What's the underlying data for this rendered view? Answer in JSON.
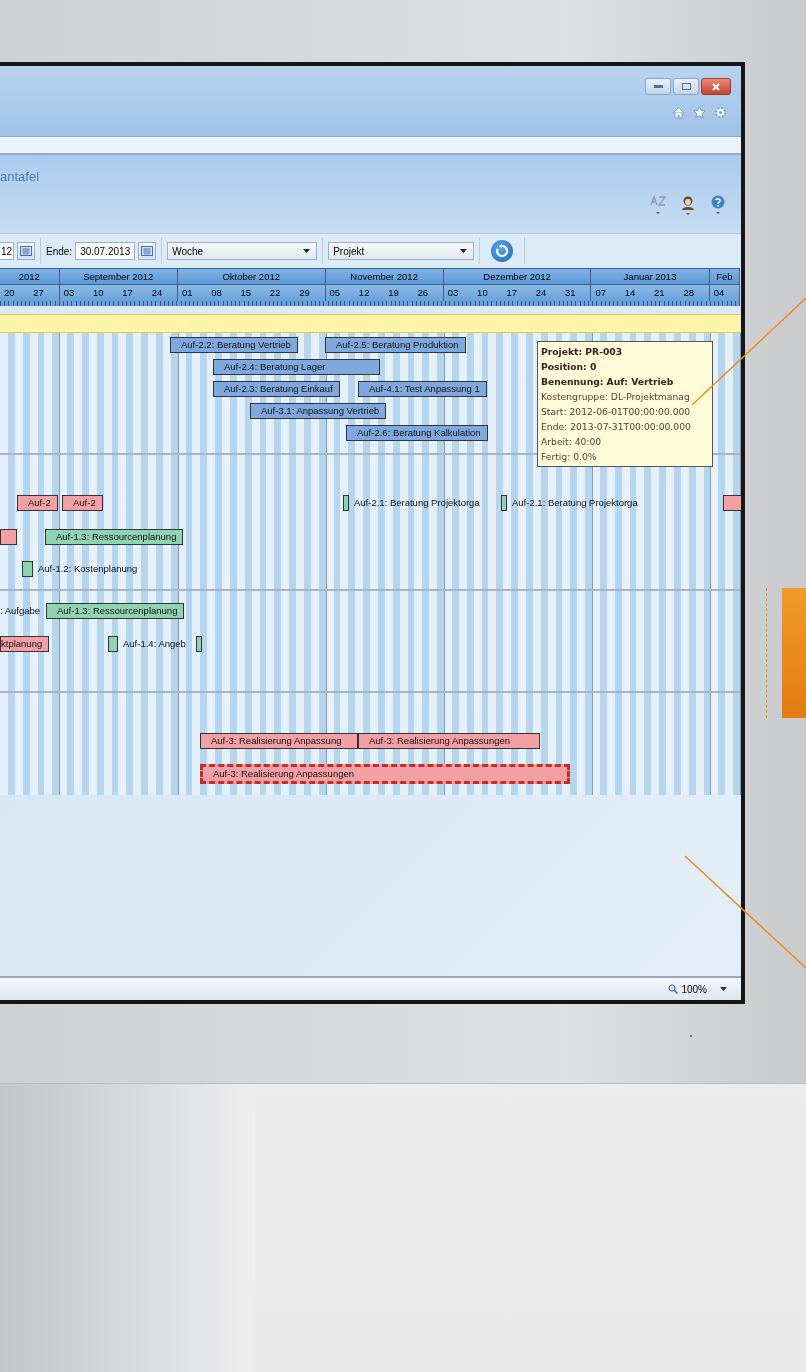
{
  "page_header": {
    "title": "antafel"
  },
  "toolbar": {
    "start_date": "12",
    "end_label": "Ende:",
    "end_date": "30.07.2013",
    "scale": "Woche",
    "grouping": "Projekt"
  },
  "timeline": {
    "months": [
      {
        "label": "2012",
        "weeks": [
          "20",
          "27"
        ]
      },
      {
        "label": "September 2012",
        "weeks": [
          "03",
          "10",
          "17",
          "24"
        ]
      },
      {
        "label": "Oktober 2012",
        "weeks": [
          "01",
          "08",
          "15",
          "22",
          "29"
        ]
      },
      {
        "label": "November 2012",
        "weeks": [
          "05",
          "12",
          "19",
          "26"
        ]
      },
      {
        "label": "Dezember 2012",
        "weeks": [
          "03",
          "10",
          "17",
          "24",
          "31"
        ]
      },
      {
        "label": "Januar 2013",
        "weeks": [
          "07",
          "14",
          "21",
          "28"
        ]
      },
      {
        "label": "Feb",
        "weeks": [
          "04"
        ]
      }
    ]
  },
  "bars": [
    {
      "label": "Auf-2.2: Beratung Vertrieb",
      "color": "#7fa9de",
      "selected": false
    },
    {
      "label": "Auf-2.5: Beratung Produktion",
      "color": "#7fa9de",
      "selected": false
    },
    {
      "label": "Auf-2.4: Beratung Lager",
      "color": "#7fa9de",
      "selected": false
    },
    {
      "label": "Auf-2.3: Beratung Einkauf",
      "color": "#7fa9de",
      "selected": false
    },
    {
      "label": "Auf-4.1: Test Anpassung 1",
      "color": "#7fa9de",
      "selected": false
    },
    {
      "label": "Auf-3.1: Anpassung Vertrieb",
      "color": "#7fa9de",
      "selected": false
    },
    {
      "label": "Auf-2.6: Beratung Kalkulation",
      "color": "#7fa9de",
      "selected": false
    },
    {
      "label": "Auf-2",
      "color": "#f2a0a4",
      "selected": false
    },
    {
      "label": "Auf-2",
      "color": "#f2a0a4",
      "selected": false
    },
    {
      "label": "Auf-2.1: Beratung Projektorga",
      "color": "#8fd3b0",
      "selected": false
    },
    {
      "label": "Auf-2.1: Beratung Projektorga",
      "color": "#8fd3b0",
      "selected": false
    },
    {
      "color": "#f2a0a4",
      "selected": false
    },
    {
      "color": "#f2a0a4",
      "selected": false
    },
    {
      "label": "Auf-1.3: Ressourcenplanung",
      "color": "#8fd3b0",
      "selected": false
    },
    {
      "label": "Auf-1.2: Kostenplanung",
      "color": "#8fd3b0",
      "selected": false
    },
    {
      "label": "Auf-1.3: Ressourcenplanung",
      "color": "#8fd3b0",
      "selected": false
    },
    {
      "label": "ktplanung",
      "color": "#f2a0a4",
      "selected": false
    },
    {
      "label": "Auf-1.4: Angeb",
      "color": "#8fd3b0",
      "selected": false
    },
    {
      "color": "#8fd3b0",
      "selected": false
    },
    {
      "label": "Auf-3: Realisierung Anpassung",
      "color": "#f2a0a4",
      "selected": false
    },
    {
      "label": "Auf-3: Realisierung Anpassungen",
      "color": "#f2a0a4",
      "selected": false
    },
    {
      "label": "Auf-3: Realisierung Anpassungen",
      "color": "#f2a0a4",
      "selected": true
    }
  ],
  "loose_labels": [
    ": Aufgabe"
  ],
  "tooltip": [
    {
      "text": "Projekt: PR-003",
      "kind": "heading"
    },
    {
      "text": "Position: 0",
      "kind": "heading"
    },
    {
      "text": "Benennung: Auf: Vertrieb",
      "kind": "heading"
    },
    {
      "text": "Kostengruppe: DL-Projektmanag",
      "kind": "detail"
    },
    {
      "text": "Start: 2012-06-01T00:00:00.000",
      "kind": "detail"
    },
    {
      "text": "Ende: 2013-07-31T00:00:00.000",
      "kind": "detail"
    },
    {
      "text": "Arbeit: 40:00",
      "kind": "detail"
    },
    {
      "text": "Fertig: 0.0%",
      "kind": "detail"
    }
  ],
  "status_bar": {
    "zoom": "100%"
  }
}
